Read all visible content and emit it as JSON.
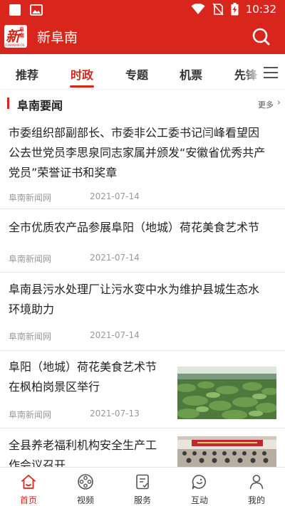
{
  "status_bar": {
    "time": "10:32",
    "icons": [
      "gallery-icon",
      "image-icon",
      "wifi-icon",
      "no-sim-icon",
      "battery-charging-icon"
    ]
  },
  "app": {
    "title": "新阜南",
    "logo_text": "新",
    "logo_side_text": "阜南",
    "logo_sub_text": "FUNANXW.CN",
    "brand_color": "#d8261c",
    "search_icon": "search-icon"
  },
  "tabs": {
    "items": [
      "推荐",
      "时政",
      "专题",
      "机票",
      "先锋"
    ],
    "active": "时政",
    "menu_icon": "menu-icon"
  },
  "section": {
    "title": "阜南要闻",
    "more_label": "更多"
  },
  "news": [
    {
      "title_lines": [
        "市委组织部副部长、市委非公工委书记闫峰看望因",
        "公去世党员李思泉同志家属并颁发“安徽省优秀共产",
        "党员”荣誉证书和奖章"
      ],
      "source": "阜南新闻网",
      "date": "2021-07-14"
    },
    {
      "title_lines": [
        "全市优质农产品参展阜阳（地城）荷花美食艺术节"
      ],
      "source": "阜南新闻网",
      "date": "2021-07-14"
    },
    {
      "title_lines": [
        "阜南县污水处理厂让污水变中水为维护县城生态水",
        "环境助力"
      ],
      "source": "阜南新闻网",
      "date": "2021-07-14"
    },
    {
      "title_lines": [
        "阜阳（地城）荷花美食艺术节",
        "在枫柏岗景区举行"
      ],
      "source": "阜南新闻网",
      "date": "2021-07-13",
      "thumbnail": "lotus-field-photo"
    },
    {
      "title_lines": [
        "全县养老福利机构安全生产工",
        "作会议召开"
      ],
      "thumbnail": "meeting-hall-photo"
    }
  ],
  "bottom_nav": {
    "items": [
      {
        "label": "首页",
        "icon": "home-icon"
      },
      {
        "label": "视频",
        "icon": "film-reel-icon"
      },
      {
        "label": "服务",
        "icon": "service-document-icon"
      },
      {
        "label": "互动",
        "icon": "chat-bubble-icon"
      },
      {
        "label": "我的",
        "icon": "person-icon"
      }
    ],
    "active": "首页"
  }
}
